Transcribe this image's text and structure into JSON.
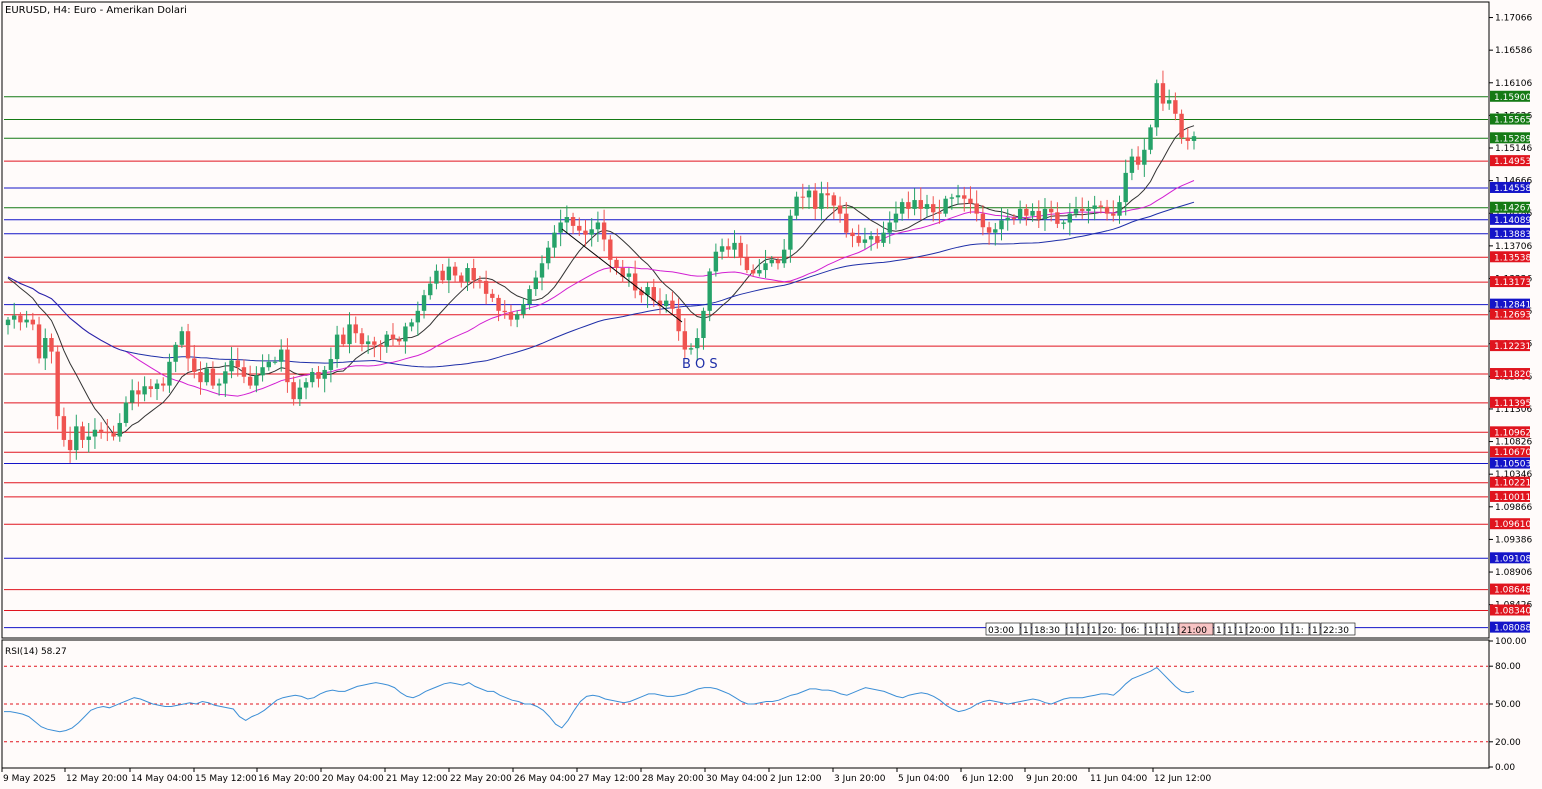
{
  "window": {
    "title": "EURUSD, H4:  Euro - Amerikan Dolari",
    "background": "#fffbfa",
    "axis_color": "#000000"
  },
  "bos_label": "B O S",
  "chart_data": {
    "type": "candlestick",
    "symbol": "EURUSD",
    "timeframe": "H4",
    "ylim": [
      1.0795,
      1.1728
    ],
    "price_ticks": [
      "1.17066",
      "1.16586",
      "1.16106",
      "1.15626",
      "1.15146",
      "1.14666",
      "1.14186",
      "1.13706",
      "1.13226",
      "1.12746",
      "1.12266",
      "1.11786",
      "1.11306",
      "1.10826",
      "1.10346",
      "1.09866",
      "1.09386",
      "1.08906",
      "1.08426"
    ],
    "time_labels": [
      "9 May 2025",
      "12 May 20:00",
      "14 May 04:00",
      "15 May 12:00",
      "16 May 20:00",
      "20 May 04:00",
      "21 May 12:00",
      "22 May 20:00",
      "26 May 04:00",
      "27 May 12:00",
      "28 May 20:00",
      "30 May 04:00",
      "2 Jun 12:00",
      "3 Jun 20:00",
      "5 Jun 04:00",
      "6 Jun 12:00",
      "9 Jun 20:00",
      "11 Jun 04:00",
      "12 Jun 12:00"
    ],
    "colors": {
      "bull": "#26a269",
      "bear": "#ef5350",
      "sma_fast": "#333333",
      "sma_mid": "#d21fd2",
      "sma_slow": "#1f2fa8",
      "rsi": "#3d8fd6"
    },
    "levels": [
      {
        "label": "1.15900",
        "value": 1.159,
        "color": "#157a15"
      },
      {
        "label": "1.15565",
        "value": 1.15565,
        "color": "#157a15"
      },
      {
        "label": "1.15289",
        "value": 1.15289,
        "color": "#157a15"
      },
      {
        "label": "1.14953",
        "value": 1.14953,
        "color": "#e0141e"
      },
      {
        "label": "1.14558",
        "value": 1.14558,
        "color": "#1414c8"
      },
      {
        "label": "1.14267",
        "value": 1.14267,
        "color": "#157a15"
      },
      {
        "label": "1.14089",
        "value": 1.14089,
        "color": "#1414c8"
      },
      {
        "label": "1.13883",
        "value": 1.13883,
        "color": "#1414c8"
      },
      {
        "label": "1.13538",
        "value": 1.13538,
        "color": "#e0141e"
      },
      {
        "label": "1.13173",
        "value": 1.13173,
        "color": "#e0141e"
      },
      {
        "label": "1.12841",
        "value": 1.12841,
        "color": "#1414c8"
      },
      {
        "label": "1.12693",
        "value": 1.12693,
        "color": "#e0141e"
      },
      {
        "label": "1.12231",
        "value": 1.12231,
        "color": "#e0141e"
      },
      {
        "label": "1.11820",
        "value": 1.1182,
        "color": "#e0141e"
      },
      {
        "label": "1.11395",
        "value": 1.11395,
        "color": "#e0141e"
      },
      {
        "label": "1.10962",
        "value": 1.10962,
        "color": "#e0141e"
      },
      {
        "label": "1.10670",
        "value": 1.1067,
        "color": "#e0141e"
      },
      {
        "label": "1.10503",
        "value": 1.10503,
        "color": "#1414c8"
      },
      {
        "label": "1.10221",
        "value": 1.10221,
        "color": "#e0141e"
      },
      {
        "label": "1.10011",
        "value": 1.10011,
        "color": "#e0141e"
      },
      {
        "label": "1.09610",
        "value": 1.0961,
        "color": "#e0141e"
      },
      {
        "label": "1.09108",
        "value": 1.09108,
        "color": "#1414c8"
      },
      {
        "label": "1.08648",
        "value": 1.08648,
        "color": "#e0141e"
      },
      {
        "label": "1.08340",
        "value": 1.0834,
        "color": "#e0141e"
      },
      {
        "label": "1.08088",
        "value": 1.08088,
        "color": "#1414c8"
      }
    ],
    "closes": [
      1.1262,
      1.1268,
      1.1258,
      1.1262,
      1.1255,
      1.1205,
      1.1235,
      1.1215,
      1.112,
      1.1085,
      1.107,
      1.1105,
      1.1085,
      1.109,
      1.11,
      1.1097,
      1.1095,
      1.109,
      1.111,
      1.114,
      1.1158,
      1.1152,
      1.1164,
      1.116,
      1.1168,
      1.1165,
      1.12,
      1.1225,
      1.1245,
      1.1205,
      1.1185,
      1.117,
      1.119,
      1.1165,
      1.1168,
      1.1186,
      1.1202,
      1.1192,
      1.1178,
      1.1165,
      1.118,
      1.1192,
      1.12,
      1.12,
      1.1218,
      1.117,
      1.1145,
      1.1162,
      1.117,
      1.1185,
      1.1175,
      1.1188,
      1.1204,
      1.124,
      1.1226,
      1.1255,
      1.1242,
      1.1226,
      1.123,
      1.1225,
      1.1222,
      1.124,
      1.1233,
      1.123,
      1.1252,
      1.1258,
      1.1275,
      1.1298,
      1.1315,
      1.1334,
      1.132,
      1.134,
      1.1327,
      1.1318,
      1.1338,
      1.132,
      1.1319,
      1.13,
      1.1294,
      1.1275,
      1.1273,
      1.1262,
      1.127,
      1.1285,
      1.1307,
      1.1324,
      1.1345,
      1.1368,
      1.139,
      1.1405,
      1.1413,
      1.14,
      1.1393,
      1.1387,
      1.1395,
      1.1405,
      1.138,
      1.135,
      1.1338,
      1.1325,
      1.133,
      1.1305,
      1.1298,
      1.131,
      1.129,
      1.1282,
      1.129,
      1.1278,
      1.1245,
      1.1218,
      1.122,
      1.1235,
      1.1275,
      1.1333,
      1.1362,
      1.137,
      1.1365,
      1.1375,
      1.1353,
      1.1335,
      1.133,
      1.1335,
      1.1345,
      1.135,
      1.1345,
      1.1365,
      1.1415,
      1.1443,
      1.1442,
      1.1452,
      1.1425,
      1.1448,
      1.1445,
      1.143,
      1.1418,
      1.139,
      1.1385,
      1.1375,
      1.138,
      1.1385,
      1.1375,
      1.139,
      1.1405,
      1.1418,
      1.1435,
      1.1425,
      1.1438,
      1.1425,
      1.1432,
      1.142,
      1.1418,
      1.144,
      1.1442,
      1.1445,
      1.144,
      1.1433,
      1.1418,
      1.1398,
      1.139,
      1.1395,
      1.1408,
      1.1412,
      1.141,
      1.1425,
      1.1415,
      1.1422,
      1.141,
      1.1425,
      1.142,
      1.1403,
      1.1405,
      1.1418,
      1.1425,
      1.1422,
      1.1425,
      1.143,
      1.1428,
      1.1418,
      1.1415,
      1.1435,
      1.1478,
      1.1502,
      1.149,
      1.1512,
      1.1545,
      1.161,
      1.158,
      1.1585,
      1.1565,
      1.153,
      1.1525,
      1.1532
    ]
  },
  "rsi": {
    "label": "RSI(14) 58.27",
    "ylim": [
      0,
      100
    ],
    "ticks": [
      "100.00",
      "80.00",
      "50.00",
      "20.00",
      "0.00"
    ],
    "levels": [
      80,
      50,
      20
    ],
    "values": [
      44,
      44,
      43,
      42,
      40,
      36,
      32,
      30,
      29,
      28,
      29,
      31,
      35,
      40,
      45,
      47,
      48,
      47,
      49,
      51,
      53,
      55,
      54,
      52,
      50,
      49,
      48,
      48,
      49,
      50,
      51,
      50,
      52,
      51,
      49,
      48,
      47,
      46,
      40,
      37,
      40,
      42,
      45,
      49,
      53,
      55,
      56,
      57,
      56,
      54,
      55,
      58,
      60,
      61,
      60,
      60,
      62,
      64,
      65,
      66,
      67,
      66,
      65,
      63,
      59,
      56,
      55,
      57,
      60,
      62,
      64,
      66,
      67,
      66,
      65,
      67,
      64,
      62,
      60,
      60,
      57,
      55,
      53,
      52,
      50,
      50,
      48,
      45,
      40,
      34,
      31,
      37,
      45,
      52,
      56,
      57,
      56,
      54,
      53,
      52,
      51,
      52,
      54,
      56,
      58,
      58,
      57,
      56,
      56,
      57,
      58,
      60,
      62,
      63,
      63,
      62,
      60,
      58,
      55,
      52,
      50,
      50,
      51,
      52,
      52,
      53,
      55,
      57,
      58,
      60,
      62,
      62,
      61,
      61,
      60,
      58,
      57,
      59,
      61,
      63,
      62,
      61,
      60,
      58,
      56,
      55,
      57,
      58,
      59,
      58,
      56,
      53,
      49,
      46,
      44,
      45,
      47,
      50,
      52,
      53,
      52,
      51,
      50,
      51,
      52,
      53,
      54,
      53,
      51,
      50,
      52,
      54,
      55,
      55,
      55,
      56,
      57,
      58,
      58,
      57,
      61,
      66,
      70,
      72,
      74,
      76,
      79,
      74,
      69,
      64,
      60,
      59,
      60
    ]
  },
  "time_strip": [
    "03:00",
    "1",
    "18:30",
    "1",
    "1",
    "1",
    "20:",
    "06:",
    "1",
    "1",
    "1",
    "21:00",
    "1",
    "1",
    "1",
    "20:00",
    "1",
    "1:",
    "1",
    "22:30"
  ]
}
